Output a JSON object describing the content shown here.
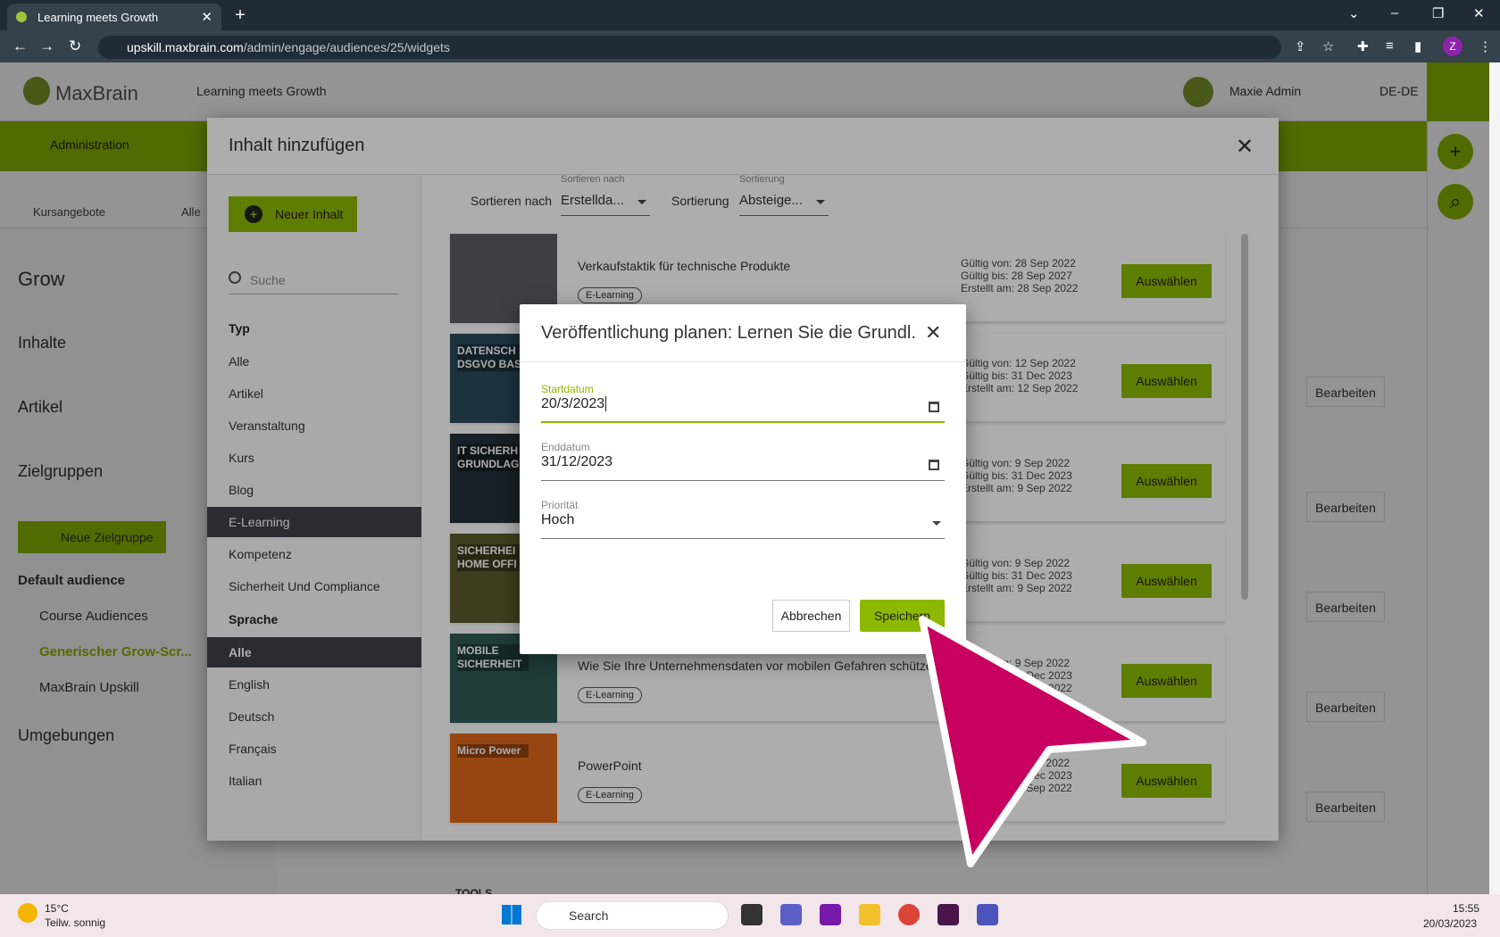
{
  "browser": {
    "tab_title": "Learning meets Growth",
    "url_host": "upskill.maxbrain.com",
    "url_path": "/admin/engage/audiences/25/widgets",
    "profile_initial": "Z"
  },
  "app": {
    "logo": "MaxBrain",
    "slogan": "Learning meets Growth",
    "user": "Maxie Admin",
    "lang": "DE-DE",
    "nav_admin": "Administration",
    "subnav_courses": "Kursangebote",
    "subnav_all": "Alle"
  },
  "sidebar": {
    "title": "Grow",
    "inhalte": "Inhalte",
    "artikel": "Artikel",
    "zielgruppen": "Zielgruppen",
    "new_group": "Neue Zielgruppe",
    "default_aud": "Default audience",
    "course_aud": "Course Audiences",
    "generic": "Generischer Grow-Scr...",
    "upskill": "MaxBrain Upskill",
    "umgebungen": "Umgebungen",
    "tools": "TOOLS"
  },
  "edit_label": "Bearbeiten",
  "modal": {
    "title": "Inhalt hinzufügen",
    "new_content": "Neuer Inhalt",
    "search_placeholder": "Suche",
    "filter_type_head": "Typ",
    "filter_types": [
      "Alle",
      "Artikel",
      "Veranstaltung",
      "Kurs",
      "Blog",
      "E-Learning",
      "Kompetenz",
      "Sicherheit Und Compliance"
    ],
    "filter_lang_head": "Sprache",
    "filter_langs": [
      "Alle",
      "English",
      "Deutsch",
      "Français",
      "Italian"
    ],
    "sort_by_label": "Sortieren nach",
    "sort_by_float": "Sortieren nach",
    "sort_by_value": "Erstellda...",
    "sort_order_label": "Sortierung",
    "sort_order_float": "Sortierung",
    "sort_order_value": "Absteige...",
    "select_label": "Auswählen",
    "cards": [
      {
        "title": "Verkaufstaktik für technische Produkte",
        "badge": "E-Learning",
        "d1": "Gültig von: 28 Sep 2022",
        "d2": "Gültig bis: 28 Sep 2027",
        "d3": "Erstellt am: 28 Sep 2022",
        "thumb_text": "",
        "thumb_color": "#5a5f64"
      },
      {
        "title": "",
        "badge": "",
        "d1": "Gültig von: 12 Sep 2022",
        "d2": "Gültig bis: 31 Dec 2023",
        "d3": "Erstellt am: 12 Sep 2022",
        "thumb_text": "DATENSCH DSGVO BAS",
        "thumb_color": "#2a4a5a"
      },
      {
        "title": "",
        "badge": "",
        "d1": "Gültig von: 9 Sep 2022",
        "d2": "Gültig bis: 31 Dec 2023",
        "d3": "Erstellt am: 9 Sep 2022",
        "thumb_text": "IT SICHERH GRUNDLAG",
        "thumb_color": "#233038"
      },
      {
        "title": "",
        "badge": "",
        "d1": "Gültig von: 9 Sep 2022",
        "d2": "Gültig bis: 31 Dec 2023",
        "d3": "Erstellt am: 9 Sep 2022",
        "thumb_text": "SICHERHEI HOME OFFI",
        "thumb_color": "#5c5a2c"
      },
      {
        "title": "Wie Sie Ihre Unternehmensdaten vor mobilen Gefahren schützen",
        "badge": "E-Learning",
        "d1": "Gültig von: 9 Sep 2022",
        "d2": "Gültig bis: 31 Dec 2023",
        "d3": "Erstellt am: 9 Sep 2022",
        "thumb_text": "MOBILE SICHERHEIT",
        "thumb_color": "#2f5a55"
      },
      {
        "title": "PowerPoint",
        "badge": "E-Learning",
        "d1": "Gültig von: 8 Sep 2022",
        "d2": "Gültig bis: 31 Dec 2023",
        "d3": "Erstellt am: 8 Sep 2022",
        "thumb_text": "Micro Power",
        "thumb_color": "#e0681a"
      }
    ]
  },
  "dialog": {
    "title": "Veröffentlichung planen: Lernen Sie die Grundl...",
    "start_label": "Startdatum",
    "start_value": "20/3/2023",
    "end_label": "Enddatum",
    "end_value": "31/12/2023",
    "prio_label": "Priorität",
    "prio_value": "Hoch",
    "cancel": "Abbrechen",
    "save": "Speichern"
  },
  "taskbar": {
    "temp": "15°C",
    "weather": "Teilw. sonnig",
    "search": "Search",
    "time": "15:55",
    "date": "20/03/2023"
  },
  "colors": {
    "accent": "#8cb800",
    "arrow": "#c8005f"
  }
}
